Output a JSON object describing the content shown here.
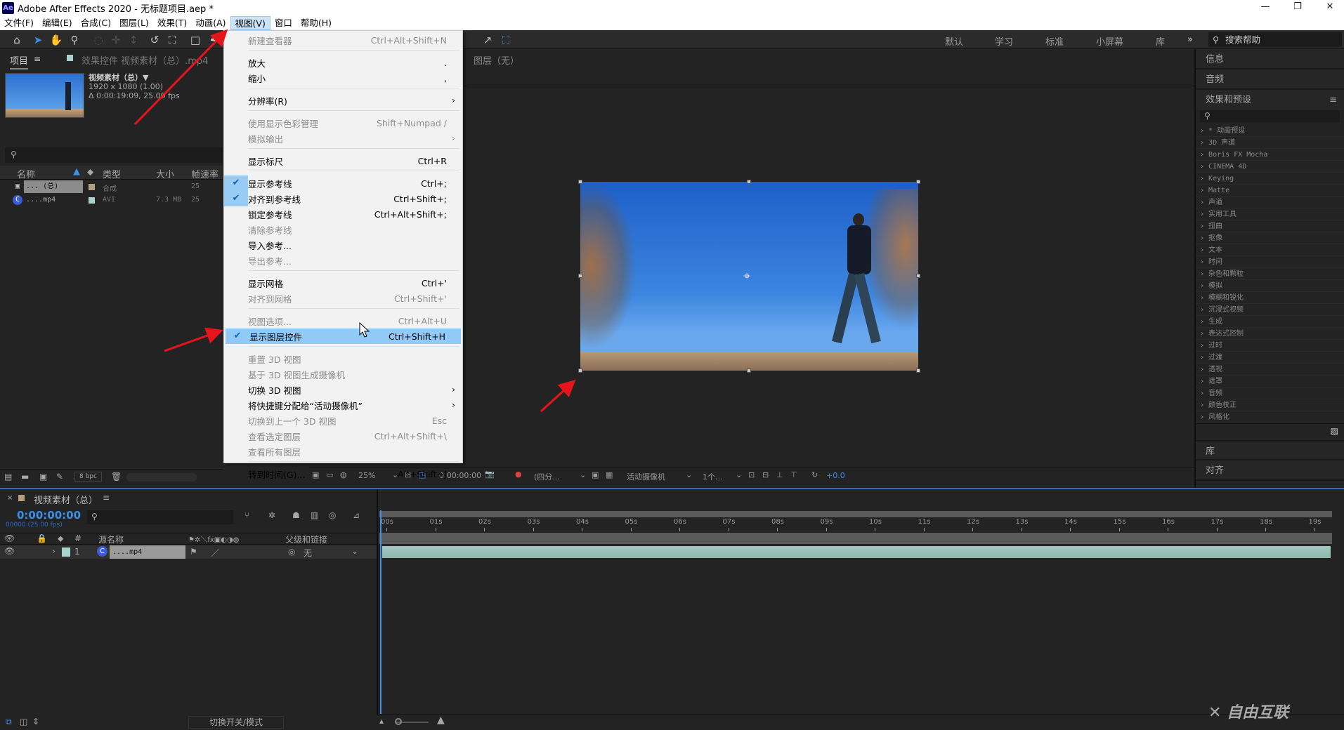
{
  "window": {
    "app_icon": "Ae",
    "title": "Adobe After Effects 2020 - 无标题项目.aep *",
    "minimize": "—",
    "restore": "❐",
    "close": "✕"
  },
  "menubar": [
    "文件(F)",
    "编辑(E)",
    "合成(C)",
    "图层(L)",
    "效果(T)",
    "动画(A)",
    "视图(V)",
    "窗口",
    "帮助(H)"
  ],
  "active_menu": "视图(V)",
  "toolbar": {
    "workspaces": [
      "默认",
      "学习",
      "标准",
      "小屏幕",
      "库"
    ],
    "more": "»",
    "help_search": "搜索帮助"
  },
  "project": {
    "tab": "项目",
    "tab2": "效果控件 视频素材（总）.mp4",
    "item_name": "视频素材（总）▼",
    "resolution": "1920 x 1080 (1.00)",
    "duration": "Δ 0:00:19:09, 25.00 fps",
    "columns": [
      "名称",
      "类型",
      "大小",
      "帧速率"
    ],
    "rows": [
      {
        "name": "... (总)",
        "type": "合成",
        "size": "",
        "fps": "25",
        "color": "#b59e7e"
      },
      {
        "name": "....mp4",
        "type": "AVI",
        "size": "7.3 MB",
        "fps": "25",
        "color": "#a9d3cf"
      }
    ],
    "bpc": "8 bpc"
  },
  "view_menu": [
    {
      "label": "新建查看器",
      "shortcut": "Ctrl+Alt+Shift+N",
      "disabled": true
    },
    {
      "sep": true
    },
    {
      "label": "放大",
      "shortcut": "."
    },
    {
      "label": "缩小",
      "shortcut": ","
    },
    {
      "sep": true
    },
    {
      "label": "分辨率(R)",
      "submenu": true
    },
    {
      "sep": true
    },
    {
      "label": "使用显示色彩管理",
      "shortcut": "Shift+Numpad /",
      "disabled": true
    },
    {
      "label": "模拟输出",
      "submenu": true,
      "disabled": true
    },
    {
      "sep": true
    },
    {
      "label": "显示标尺",
      "shortcut": "Ctrl+R"
    },
    {
      "sep": true
    },
    {
      "label": "显示参考线",
      "shortcut": "Ctrl+;",
      "checked": true
    },
    {
      "label": "对齐到参考线",
      "shortcut": "Ctrl+Shift+;",
      "checked": true
    },
    {
      "label": "锁定参考线",
      "shortcut": "Ctrl+Alt+Shift+;"
    },
    {
      "label": "清除参考线",
      "disabled": true
    },
    {
      "label": "导入参考..."
    },
    {
      "label": "导出参考...",
      "disabled": true
    },
    {
      "sep": true
    },
    {
      "label": "显示网格",
      "shortcut": "Ctrl+'"
    },
    {
      "label": "对齐到网格",
      "shortcut": "Ctrl+Shift+'",
      "disabled": true
    },
    {
      "sep": true
    },
    {
      "label": "视图选项...",
      "shortcut": "Ctrl+Alt+U",
      "disabled": true
    },
    {
      "label": "显示图层控件",
      "shortcut": "Ctrl+Shift+H",
      "checked": true,
      "highlighted": true
    },
    {
      "sep": true
    },
    {
      "label": "重置 3D 视图",
      "disabled": true
    },
    {
      "label": "基于 3D 视图生成摄像机",
      "disabled": true
    },
    {
      "label": "切换 3D 视图",
      "submenu": true
    },
    {
      "label": "将快捷键分配给“活动摄像机”",
      "submenu": true
    },
    {
      "label": "切换到上一个 3D 视图",
      "shortcut": "Esc",
      "disabled": true
    },
    {
      "label": "查看选定图层",
      "shortcut": "Ctrl+Alt+Shift+\\",
      "disabled": true
    },
    {
      "label": "查看所有图层",
      "disabled": true
    },
    {
      "sep": true
    },
    {
      "label": "转到时间(G)...",
      "shortcut": "Alt+Shift+J"
    }
  ],
  "viewer": {
    "header": "图层（无）",
    "zoom": "25%",
    "time": "0:00:00:00",
    "resolution": "(四分...",
    "camera": "活动摄像机",
    "views": "1个...",
    "exposure": "+0.0"
  },
  "right": {
    "panels": [
      "信息",
      "音频",
      "效果和预设"
    ],
    "effects": [
      "* 动画预设",
      "3D 声道",
      "Boris FX Mocha",
      "CINEMA 4D",
      "Keying",
      "Matte",
      "声道",
      "实用工具",
      "扭曲",
      "抠像",
      "文本",
      "时间",
      "杂色和颗粒",
      "模拟",
      "模糊和锐化",
      "沉浸式视频",
      "生成",
      "表达式控制",
      "过时",
      "过渡",
      "透视",
      "遮罩",
      "音频",
      "颜色校正",
      "风格化"
    ],
    "bottom": [
      "库",
      "对齐"
    ]
  },
  "timeline": {
    "tab": "视频素材（总）",
    "timecode": "0:00:00:00",
    "frames": "00000 (25.00 fps)",
    "col_source": "源名称",
    "col_parent": "父级和链接",
    "layer": {
      "index": "1",
      "name": "....mp4",
      "parent": "无"
    },
    "ticks": [
      "00s",
      "01s",
      "02s",
      "03s",
      "04s",
      "05s",
      "06s",
      "07s",
      "08s",
      "09s",
      "10s",
      "11s",
      "12s",
      "13s",
      "14s",
      "15s",
      "16s",
      "17s",
      "18s",
      "19s"
    ],
    "toggle": "切换开关/模式"
  },
  "watermark": "自由互联"
}
